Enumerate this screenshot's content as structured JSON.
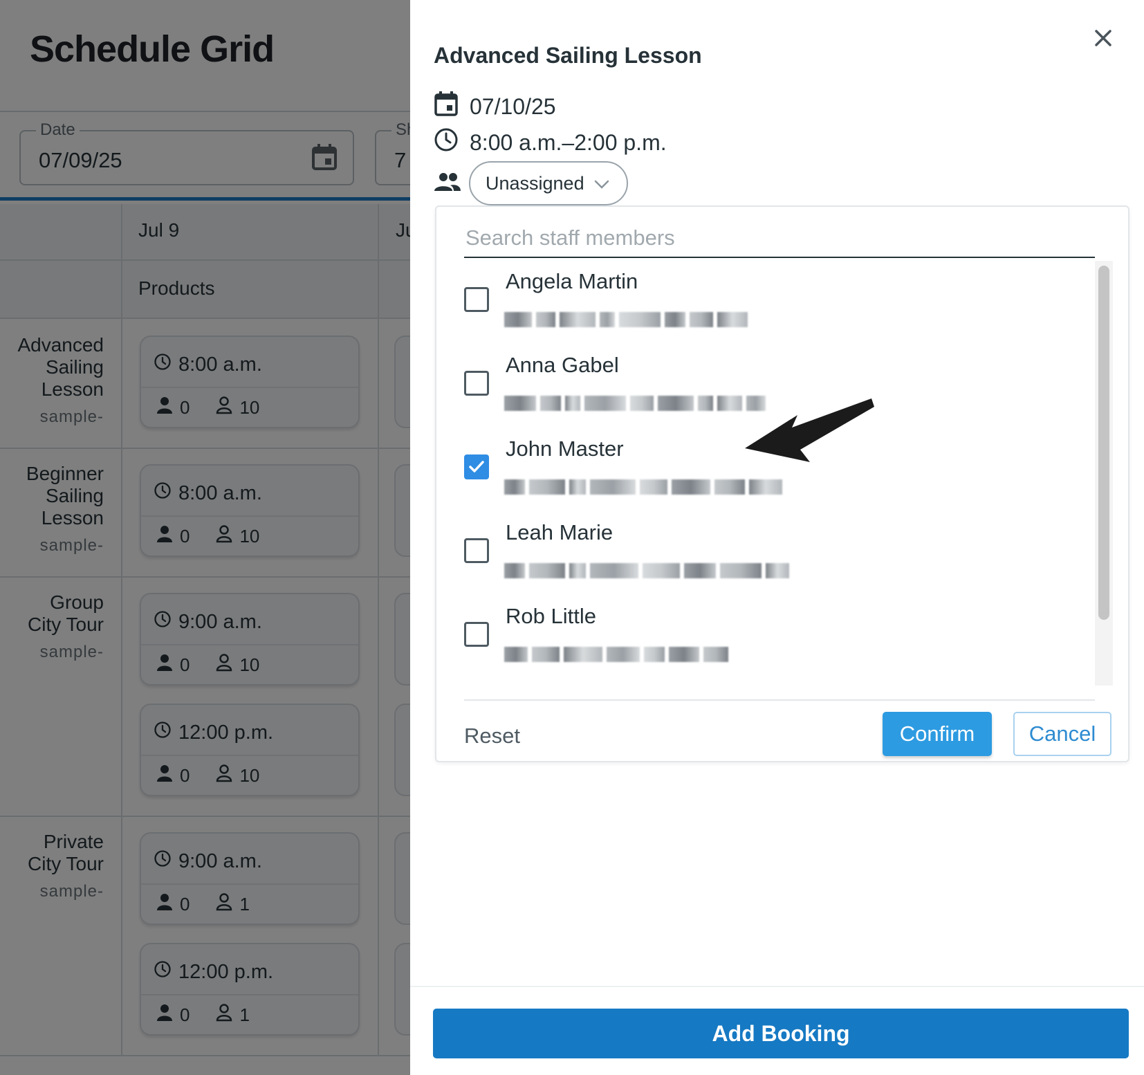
{
  "background": {
    "title": "Schedule Grid",
    "date_field": {
      "label": "Date",
      "value": "07/09/25"
    },
    "second_field": {
      "label": "Sh",
      "value": "7"
    },
    "columns": [
      {
        "label": "Jul 9",
        "sub": "Products"
      },
      {
        "label": "Ju"
      }
    ],
    "rows": [
      {
        "lines": [
          "Advanced",
          "Sailing",
          "Lesson"
        ],
        "sub": "sample-",
        "slots": [
          {
            "time": "8:00 a.m.",
            "booked": "0",
            "capacity": "10"
          }
        ]
      },
      {
        "lines": [
          "Beginner",
          "Sailing",
          "Lesson"
        ],
        "sub": "sample-",
        "slots": [
          {
            "time": "8:00 a.m.",
            "booked": "0",
            "capacity": "10"
          }
        ]
      },
      {
        "lines": [
          "Group",
          "City Tour"
        ],
        "sub": "sample-",
        "slots": [
          {
            "time": "9:00 a.m.",
            "booked": "0",
            "capacity": "10"
          },
          {
            "time": "12:00 p.m.",
            "booked": "0",
            "capacity": "10"
          }
        ]
      },
      {
        "lines": [
          "Private",
          "City Tour"
        ],
        "sub": "sample-",
        "slots": [
          {
            "time": "9:00 a.m.",
            "booked": "0",
            "capacity": "1"
          },
          {
            "time": "12:00 p.m.",
            "booked": "0",
            "capacity": "1"
          }
        ]
      }
    ]
  },
  "drawer": {
    "title": "Advanced Sailing Lesson",
    "date": "07/10/25",
    "time_range": "8:00 a.m.–2:00 p.m.",
    "assignee_button": "Unassigned",
    "staff_picker": {
      "search_placeholder": "Search staff members",
      "staff": [
        {
          "name": "Angela Martin",
          "checked": false
        },
        {
          "name": "Anna Gabel",
          "checked": false
        },
        {
          "name": "John Master",
          "checked": true
        },
        {
          "name": "Leah Marie",
          "checked": false
        },
        {
          "name": "Rob Little",
          "checked": false
        }
      ],
      "reset_label": "Reset",
      "confirm_label": "Confirm",
      "cancel_label": "Cancel"
    },
    "add_booking_label": "Add Booking"
  },
  "colors": {
    "accent": "#1679c3",
    "confirm": "#2d9be1",
    "checkbox_checked": "#2f8de4",
    "overlay": "rgba(0,0,0,0.5)"
  },
  "icons": [
    "calendar-icon",
    "clock-icon",
    "people-icon",
    "chevron-down-icon",
    "close-icon",
    "person-filled-icon",
    "person-outline-icon",
    "checkmark-icon",
    "annotation-arrow"
  ]
}
